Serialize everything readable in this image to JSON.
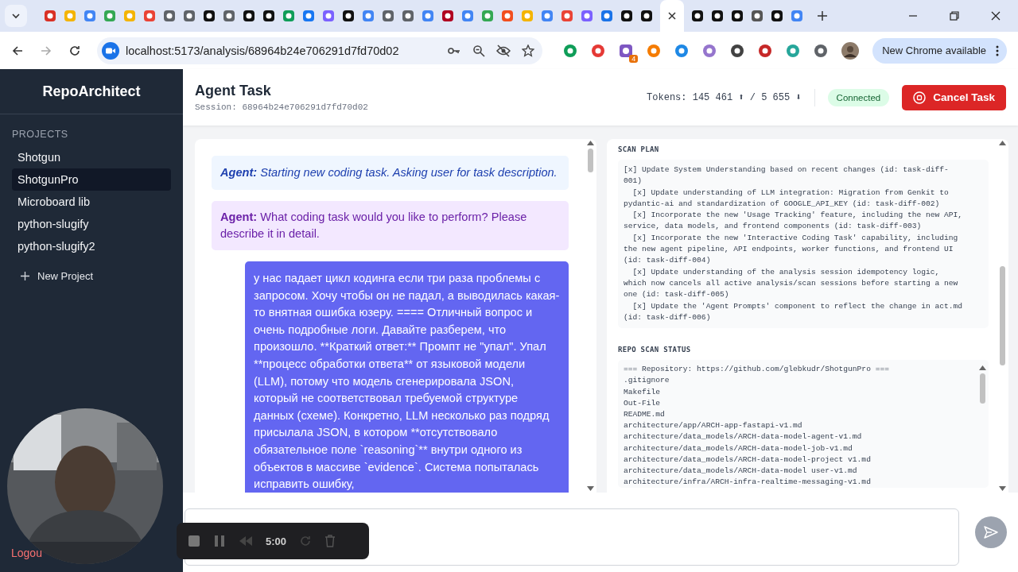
{
  "browser": {
    "url": "localhost:5173/analysis/68964b24e706291d7fd70d02",
    "extension_badge": "4",
    "update_button": "New Chrome available"
  },
  "sidebar": {
    "title": "RepoArchitect",
    "section": "PROJECTS",
    "projects": [
      {
        "label": "Shotgun",
        "selected": false
      },
      {
        "label": "ShotgunPro",
        "selected": true
      },
      {
        "label": "Microboard lib",
        "selected": false
      },
      {
        "label": "python-slugify",
        "selected": false
      },
      {
        "label": "python-slugify2",
        "selected": false
      }
    ],
    "new_project": "New Project",
    "logout": "Logou"
  },
  "header": {
    "title": "Agent Task",
    "session": "Session: 68964b24e706291d7fd70d02",
    "tokens": "Tokens: 145 461 ⬆ / 5 655 ⬇",
    "status": "Connected",
    "cancel_button": "Cancel Task"
  },
  "chat": {
    "messages": [
      {
        "kind": "status",
        "text": "**Agent:** Starting new coding task. Asking user for task description."
      },
      {
        "kind": "question",
        "text": "**Agent:** What coding task would you like to perform? Please describe it in detail."
      },
      {
        "kind": "user",
        "text": "у нас падает цикл кодинга если три раза проблемы с запросом. Хочу чтобы он не падал, а выводилась какая-то внятная ошибка юзеру. ==== Отличный вопрос и очень подробные логи. Давайте разберем, что произошло. **Краткий ответ:** Промпт не \"упал\". Упал **процесс обработки ответа** от языковой модели (LLM), потому что модель сгенерировала JSON, который не соответствовал требуемой структуре данных (схеме). Конкретно, LLM несколько раз подряд присылала JSON, в котором **отсутствовало обязательное поле `reasoning`** внутри одного из объектов в массиве `evidence`. Система попыталась исправить ошибку,"
      }
    ]
  },
  "scan_plan": {
    "title": "SCAN PLAN",
    "items": [
      "[x] Update System Understanding based on recent changes (id: task-diff-001)",
      "  [x] Update understanding of LLM integration: Migration from Genkit to pydantic-ai and standardization of GOOGLE_API_KEY (id: task-diff-002)",
      "  [x] Incorporate the new 'Usage Tracking' feature, including the new API, service, data models, and frontend components (id: task-diff-003)",
      "  [x] Incorporate the new 'Interactive Coding Task' capability, including the new agent pipeline, API endpoints, worker functions, and frontend UI (id: task-diff-004)",
      "  [x] Update understanding of the analysis session idempotency logic, which now cancels all active analysis/scan sessions before starting a new one (id: task-diff-005)",
      "  [x] Update the 'Agent Prompts' component to reflect the change in act.md (id: task-diff-006)"
    ]
  },
  "repo_status": {
    "title": "REPO SCAN STATUS",
    "lines": [
      "=== Repository: https://github.com/glebkudr/ShotgunPro ===",
      ".gitignore",
      "Makefile",
      "Out-File",
      "README.md",
      "architecture/app/ARCH-app-fastapi-v1.md",
      "architecture/data_models/ARCH-data-model-agent-v1.md",
      "architecture/data_models/ARCH-data-model-job-v1.md",
      "architecture/data_models/ARCH-data-model-project v1.md",
      "architecture/data_models/ARCH-data-model user-v1.md",
      "architecture/infra/ARCH-infra-realtime-messaging-v1.md"
    ]
  },
  "recorder": {
    "time": "5:00"
  }
}
